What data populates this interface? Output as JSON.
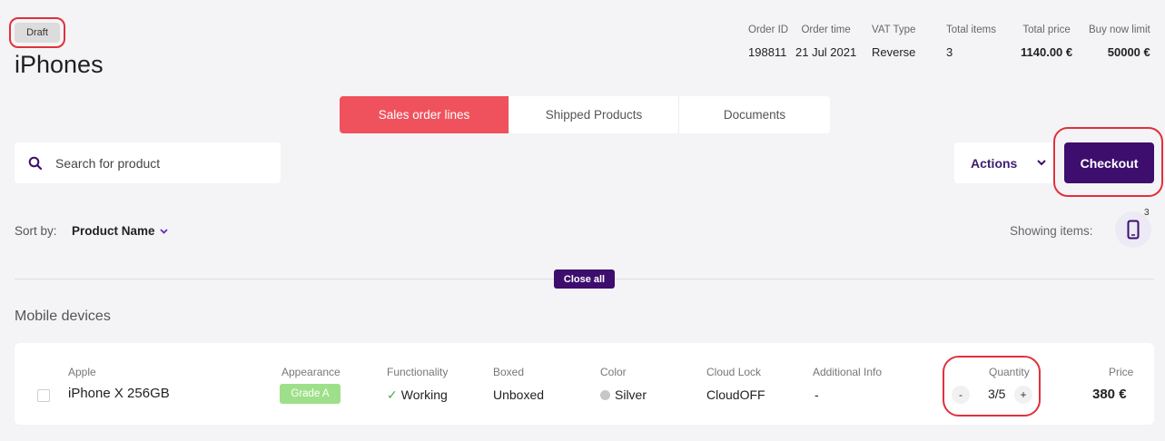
{
  "header": {
    "status_badge": "Draft",
    "title": "iPhones",
    "meta": [
      {
        "label": "Order ID",
        "value": "198811"
      },
      {
        "label": "Order time",
        "value": "21 Jul 2021"
      },
      {
        "label": "VAT Type",
        "value": "Reverse"
      },
      {
        "label": "Total items",
        "value": "3"
      },
      {
        "label": "Total price",
        "value": "1140.00 €"
      },
      {
        "label": "Buy now limit",
        "value": "50000 €"
      }
    ]
  },
  "tabs": [
    {
      "label": "Sales order lines",
      "active": true
    },
    {
      "label": "Shipped Products",
      "active": false
    },
    {
      "label": "Documents",
      "active": false
    }
  ],
  "search": {
    "placeholder": "Search for product",
    "icon": "search-icon"
  },
  "toolbar": {
    "actions_label": "Actions",
    "checkout_label": "Checkout"
  },
  "sort": {
    "label": "Sort by:",
    "value": "Product Name"
  },
  "showing": {
    "label": "Showing items:",
    "count": "3"
  },
  "close_all_label": "Close all",
  "section": {
    "title": "Mobile devices"
  },
  "product": {
    "brand": "Apple",
    "name": "iPhone X 256GB",
    "appearance_label": "Appearance",
    "appearance_value": "Grade A",
    "functionality_label": "Functionality",
    "functionality_value": "Working",
    "boxed_label": "Boxed",
    "boxed_value": "Unboxed",
    "color_label": "Color",
    "color_value": "Silver",
    "cloud_lock_label": "Cloud Lock",
    "cloud_lock_value": "CloudOFF",
    "additional_info_label": "Additional Info",
    "additional_info_value": "-",
    "quantity_label": "Quantity",
    "quantity_value": "3/5",
    "quantity_minus": "-",
    "quantity_plus": "+",
    "price_label": "Price",
    "price_value": "380 €"
  },
  "colors": {
    "accent_red": "#f0525d",
    "brand_purple": "#3d0e6d",
    "grade_green": "#9ee08a",
    "highlight_ring": "#e0313c"
  }
}
